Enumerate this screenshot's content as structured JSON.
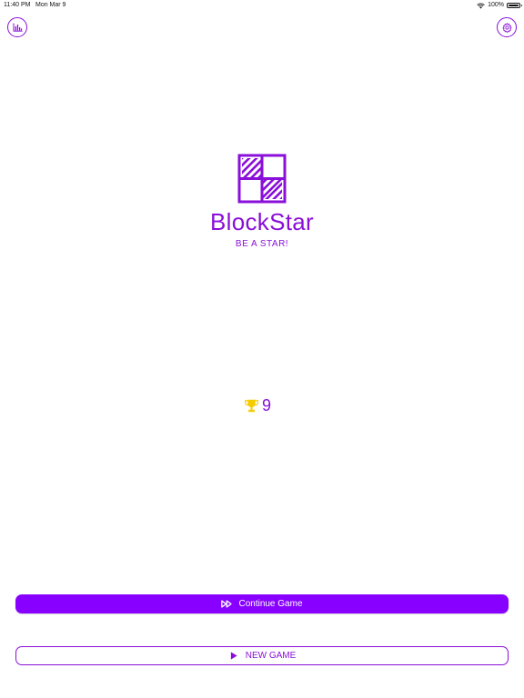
{
  "status_bar": {
    "time": "11:40 PM",
    "date": "Mon Mar 9",
    "battery": "100%"
  },
  "header": {
    "left_icon": "bar-chart-icon",
    "right_icon": "gear-icon"
  },
  "branding": {
    "app_name": "BlockStar",
    "tagline": "BE A STAR!",
    "logo_icon": "blockstar-grid-logo"
  },
  "best_score": {
    "icon": "trophy-icon",
    "value": "9"
  },
  "actions": {
    "continue_label": "Continue Game",
    "continue_icon": "fast-forward-icon",
    "new_game_label": "NEW GAME",
    "new_game_icon": "play-icon"
  },
  "colors": {
    "accent": "#8a0fd8",
    "button_fill": "#8800ff",
    "trophy": "#f5cc00",
    "background": "#ffffff"
  }
}
